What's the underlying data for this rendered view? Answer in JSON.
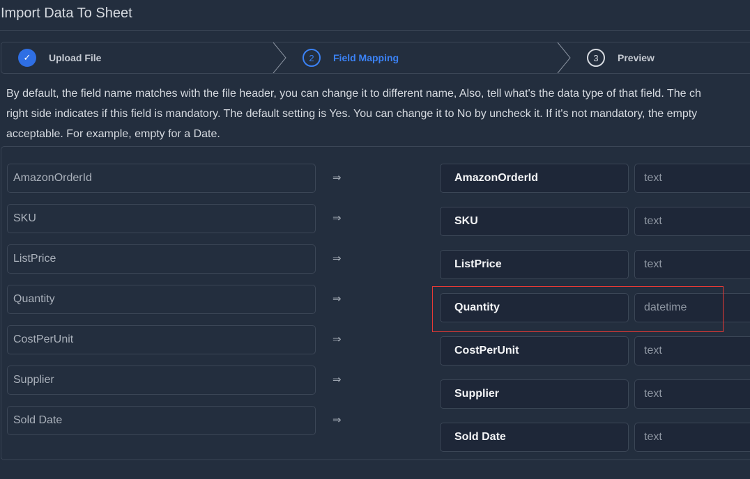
{
  "title": "Import Data To Sheet",
  "steps": [
    {
      "label": "Upload File",
      "status": "done"
    },
    {
      "number": "2",
      "label": "Field Mapping",
      "status": "active"
    },
    {
      "number": "3",
      "label": "Preview",
      "status": "pending"
    }
  ],
  "description": [
    "By default, the field name matches with the file header, you can change it to different name, Also, tell what's the data type of that field. The ch",
    "right side indicates if this field is mandatory. The default setting is Yes. You can change it to No by uncheck it. If it's not mandatory, the empty",
    "acceptable. For example, empty for a Date."
  ],
  "arrow": "⇒",
  "mappings": [
    {
      "source": "AmazonOrderId",
      "field": "AmazonOrderId",
      "type": "text"
    },
    {
      "source": "SKU",
      "field": "SKU",
      "type": "text"
    },
    {
      "source": "ListPrice",
      "field": "ListPrice",
      "type": "text"
    },
    {
      "source": "Quantity",
      "field": "Quantity",
      "type": "datetime"
    },
    {
      "source": "CostPerUnit",
      "field": "CostPerUnit",
      "type": "text"
    },
    {
      "source": "Supplier",
      "field": "Supplier",
      "type": "text"
    },
    {
      "source": "Sold Date",
      "field": "Sold Date",
      "type": "text"
    }
  ],
  "colors": {
    "accent": "#3b82f6",
    "highlight": "#e53935",
    "background": "#232e3e"
  }
}
